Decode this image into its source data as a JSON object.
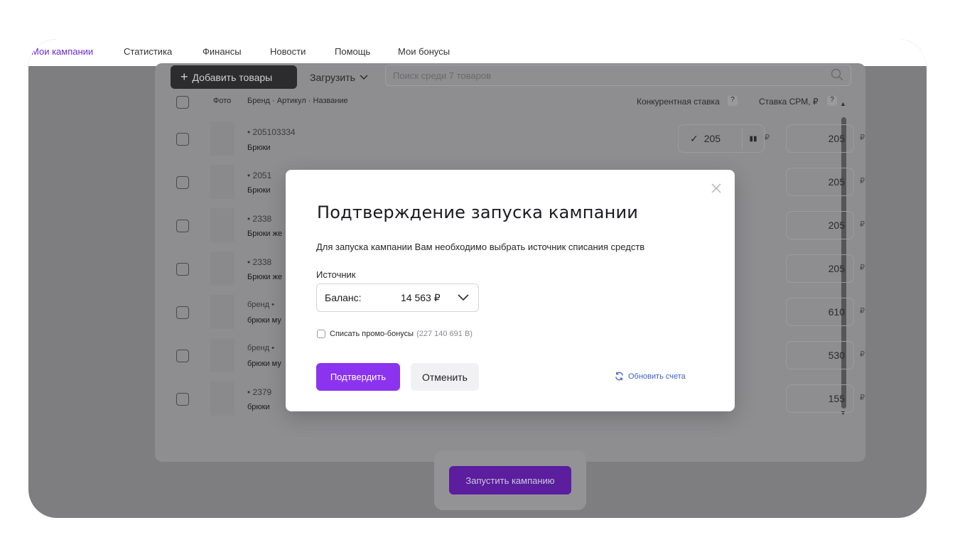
{
  "nav": {
    "items": [
      {
        "label": "Мои кампании",
        "active": true
      },
      {
        "label": "Статистика",
        "active": false
      },
      {
        "label": "Финансы",
        "active": false
      },
      {
        "label": "Новости",
        "active": false
      },
      {
        "label": "Помощь",
        "active": false
      },
      {
        "label": "Мои бонусы",
        "active": false
      }
    ]
  },
  "toolbar": {
    "add_label": "Добавить товары",
    "upload_label": "Загрузить",
    "search_placeholder": "Поиск среди 7 товаров"
  },
  "table": {
    "headers": {
      "photo": "Фото",
      "name": "Бренд · Артикул · Название",
      "competitive": "Конкурентная ставка",
      "cpm": "Ставка CPM, ₽"
    },
    "help_mark": "?",
    "currency": "₽",
    "rows": [
      {
        "sku": "•  205103334",
        "name": "Брюки",
        "competitive": "205",
        "cpm": "205"
      },
      {
        "sku": "•  2051",
        "name": "Брюки",
        "competitive": "",
        "cpm": "205"
      },
      {
        "sku": "•  2338",
        "name": "Брюки же",
        "competitive": "",
        "cpm": "205"
      },
      {
        "sku": "•  2338",
        "name": "Брюки же",
        "competitive": "",
        "cpm": "205"
      },
      {
        "sku": "бренд  •",
        "name": "брюки му",
        "competitive": "",
        "cpm": "610"
      },
      {
        "sku": "бренд  •",
        "name": "брюки му",
        "competitive": "",
        "cpm": "530"
      },
      {
        "sku": "•  2379",
        "name": "брюки",
        "competitive": "",
        "cpm": "155"
      }
    ]
  },
  "launch_label": "Запустить кампанию",
  "modal": {
    "title": "Подтверждение запуска кампании",
    "description": "Для запуска кампании Вам необходимо выбрать источник списания средств",
    "source_label": "Источник",
    "source_option": "Баланс:",
    "source_value": "14 563 ₽",
    "promo_label": "Списать промо-бонусы",
    "promo_value": "(227 140 691 B)",
    "confirm_label": "Подтвердить",
    "cancel_label": "Отменить",
    "refresh_label": "Обновить счета"
  },
  "colors": {
    "accent": "#8b33ef",
    "link": "#3d5fd1",
    "nav_active": "#6b2bd6"
  }
}
